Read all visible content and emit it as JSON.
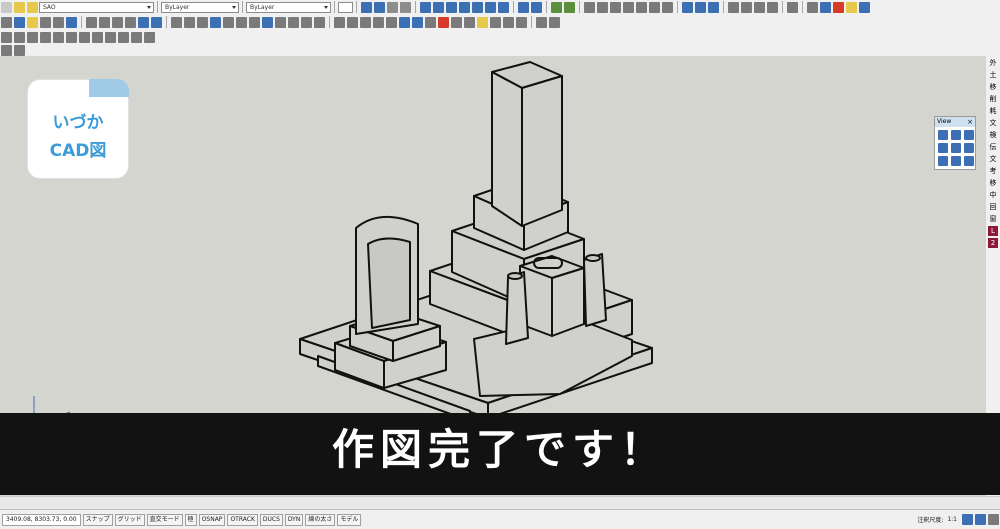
{
  "toolbar": {
    "layer_value": "SAO",
    "color_value": "ByLayer",
    "linetype_value": "ByLayer",
    "view_style_value": "ByLayer"
  },
  "logo": {
    "line1": "いづか",
    "line2": "CAD図"
  },
  "view_panel": {
    "title": "View",
    "close": "×"
  },
  "right_strip": [
    "外",
    "土",
    "移",
    "削",
    "耗",
    "文",
    "検",
    "伝",
    "文",
    "考",
    "移",
    "中",
    "回",
    "窗",
    "L",
    "2"
  ],
  "banner": {
    "text": "作図完了です！"
  },
  "statusbar": {
    "coordinates": "3409.08, 8303.73, 0.00",
    "buttons": [
      "スナップ",
      "グリッド",
      "直交モード",
      "極",
      "OSNAP",
      "OTRACK",
      "DUCS",
      "DYN",
      "線の太さ",
      "モデル"
    ],
    "annotation_scale_label": "注釈尺度:",
    "annotation_scale_value": "1:1"
  },
  "colors": {
    "viewport_bg": "#d5d5cf",
    "banner_bg": "#121212",
    "logo_text": "#3c9bd8",
    "logo_tab": "#9fcbe6",
    "model_face": "#d0d0cc"
  }
}
